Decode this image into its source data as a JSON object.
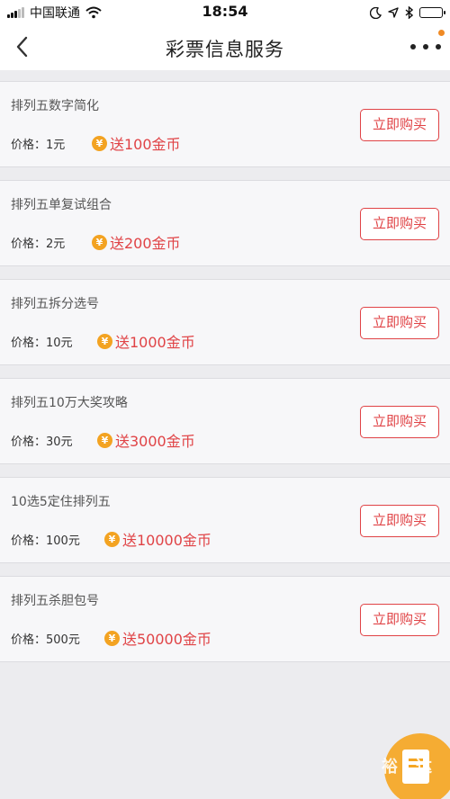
{
  "status_bar": {
    "carrier": "中国联通",
    "time": "18:54"
  },
  "nav": {
    "title": "彩票信息服务"
  },
  "coin_symbol": "¥",
  "buy_label": "立即购买",
  "price_label": "价格：",
  "items": [
    {
      "title": "排列五数字简化",
      "price": "1元",
      "gift": "送100金币"
    },
    {
      "title": "排列五单复试组合",
      "price": "2元",
      "gift": "送200金币"
    },
    {
      "title": "排列五拆分选号",
      "price": "10元",
      "gift": "送1000金币"
    },
    {
      "title": "排列五10万大奖攻略",
      "price": "30元",
      "gift": "送3000金币"
    },
    {
      "title": "10选5定住排列五",
      "price": "100元",
      "gift": "送10000金币"
    },
    {
      "title": "排列五杀胆包号",
      "price": "500元",
      "gift": "送50000金币"
    }
  ],
  "fab": {
    "watermark": "裕达"
  },
  "colors": {
    "accent": "#e04346",
    "coin": "#f3a322",
    "notification": "#f08a24"
  }
}
